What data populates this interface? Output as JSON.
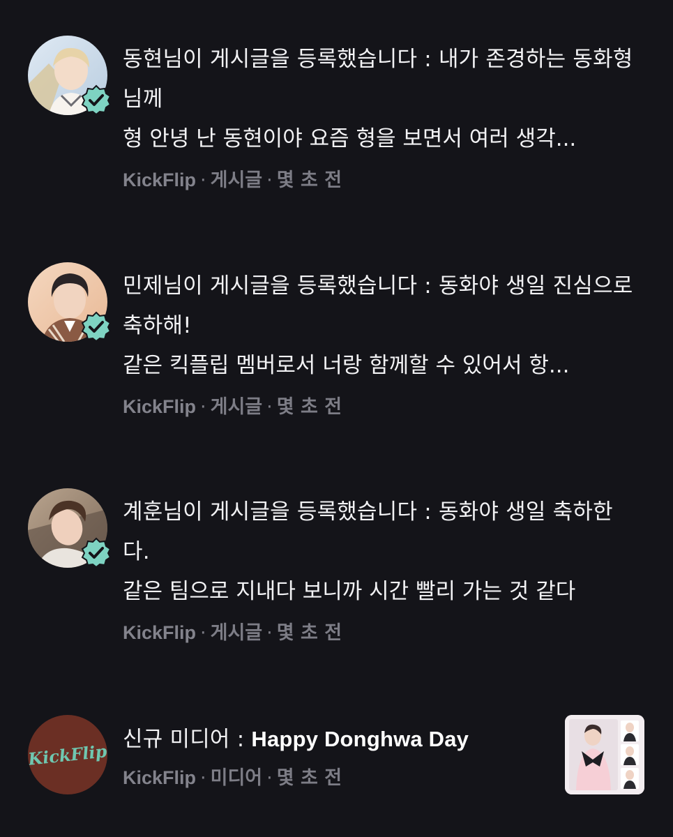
{
  "notifications": [
    {
      "message": "동현님이 게시글을 등록했습니다 : 내가 존경하는 동화형님께",
      "preview": "형 안녕 난 동현이야 요즘 형을 보면서 여러 생각...",
      "meta": {
        "source": "KickFlip",
        "type": "게시글",
        "time": "몇 초 전"
      },
      "avatar_icon": "profile-photo",
      "badge_icon": "verified-badge-icon"
    },
    {
      "message": "민제님이 게시글을 등록했습니다 : 동화야 생일 진심으로 축하해!",
      "preview": "같은 킥플립 멤버로서 너랑 함께할 수 있어서 항...",
      "meta": {
        "source": "KickFlip",
        "type": "게시글",
        "time": "몇 초 전"
      },
      "avatar_icon": "profile-photo",
      "badge_icon": "verified-badge-icon"
    },
    {
      "message": "계훈님이 게시글을 등록했습니다 : 동화야 생일 축하한다.",
      "preview": "같은 팀으로 지내다 보니까 시간 빨리 가는 것 같다",
      "meta": {
        "source": "KickFlip",
        "type": "게시글",
        "time": "몇 초 전"
      },
      "avatar_icon": "profile-photo",
      "badge_icon": "verified-badge-icon"
    },
    {
      "message_prefix": "신규 미디어 : ",
      "message_title": "Happy Donghwa Day",
      "meta": {
        "source": "KickFlip",
        "type": "미디어",
        "time": "몇 초 전"
      },
      "avatar_logo_text": "KickFlip",
      "thumbnail_icon": "media-thumbnail"
    }
  ],
  "separator": "·",
  "colors": {
    "background": "#141419",
    "text": "#f2f2f4",
    "meta": "#7d7d86",
    "badge": "#7ed3c2",
    "logo_bg": "#6b2f24",
    "logo_text": "#6fc7b0"
  }
}
